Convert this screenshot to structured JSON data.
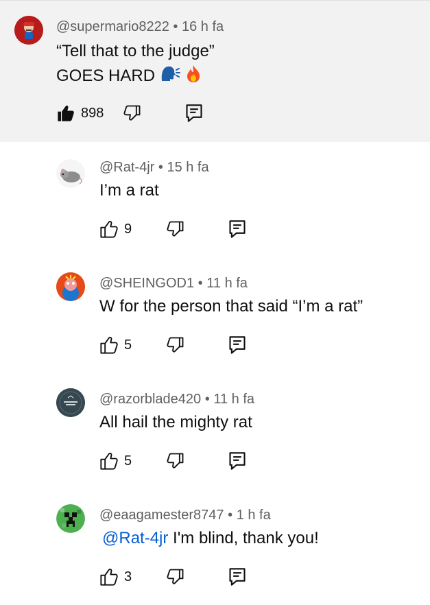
{
  "comments": [
    {
      "author": "@supermario8222",
      "time": "16 h fa",
      "lines": [
        "“Tell that to the judge”",
        "GOES HARD"
      ],
      "emojis": [
        "speaking-head-emoji",
        "fire-emoji"
      ],
      "likes": "898",
      "liked": true,
      "avatar_color": "#b71c1c"
    },
    {
      "author": "@Rat-4jr",
      "time": "15 h fa",
      "text": "I’m a rat",
      "likes": "9",
      "avatar_color": "#8d8d8d"
    },
    {
      "author": "@SHEINGOD1",
      "time": "11 h fa",
      "text": "W for the person that said “I’m a rat”",
      "likes": "5",
      "avatar_color": "#e64a19"
    },
    {
      "author": "@razorblade420",
      "time": "11 h fa",
      "text": "All hail the mighty rat",
      "likes": "5",
      "avatar_color": "#37474f",
      "avatar_text": "KILLED ME\nGAMES"
    },
    {
      "author": "@eaagamester8747",
      "time": "1 h fa",
      "mention": "@Rat-4jr",
      "text": " I'm blind, thank you!",
      "likes": "3",
      "avatar_color": "#2e7d32"
    }
  ],
  "separator": "•",
  "colors": {
    "mention": "#065fd4",
    "meta": "#606060",
    "highlight_bg": "#f2f2f2"
  }
}
